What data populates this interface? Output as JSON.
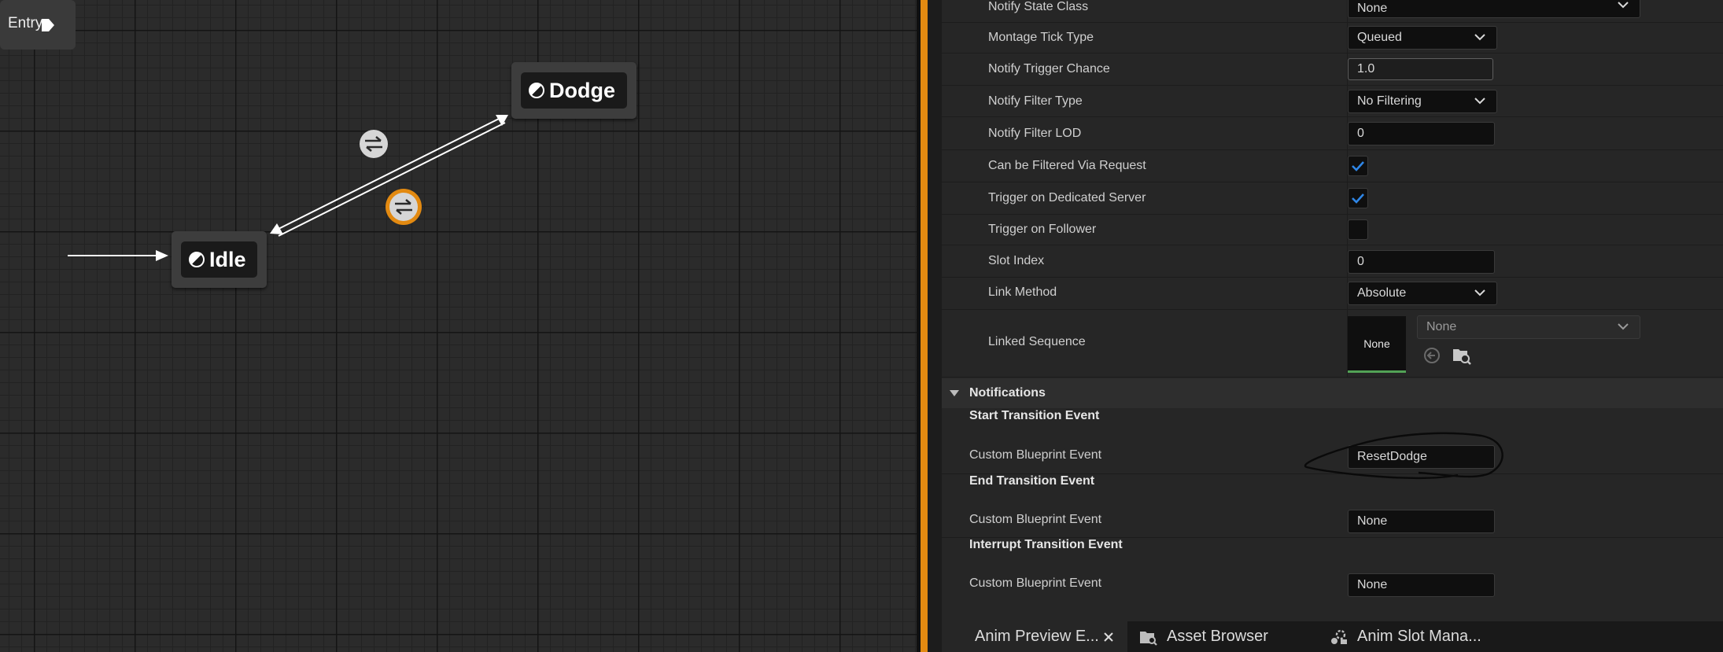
{
  "graph": {
    "nodes": {
      "entry": "Entry",
      "idle": "Idle",
      "dodge": "Dodge"
    },
    "icons": {
      "state": "state-icon",
      "transition": "transition-icon",
      "selected_transition": "transition-icon-selected",
      "entry_arrow": "play-arrow-icon"
    },
    "colors": {
      "selection": "#e38a11"
    }
  },
  "details": {
    "rows": {
      "notify_state_class": {
        "label": "Notify State Class",
        "value": "None"
      },
      "montage_tick_type": {
        "label": "Montage Tick Type",
        "value": "Queued"
      },
      "notify_trigger_chance": {
        "label": "Notify Trigger Chance",
        "value": "1.0"
      },
      "notify_filter_type": {
        "label": "Notify Filter Type",
        "value": "No Filtering"
      },
      "notify_filter_lod": {
        "label": "Notify Filter LOD",
        "value": "0"
      },
      "can_be_filtered": {
        "label": "Can be Filtered Via Request",
        "checked": true
      },
      "trigger_dedicated": {
        "label": "Trigger on Dedicated Server",
        "checked": true
      },
      "trigger_follower": {
        "label": "Trigger on Follower",
        "checked": false
      },
      "slot_index": {
        "label": "Slot Index",
        "value": "0"
      },
      "link_method": {
        "label": "Link Method",
        "value": "Absolute"
      },
      "linked_sequence": {
        "label": "Linked Sequence",
        "thumb": "None",
        "value": "None"
      }
    },
    "notifications": {
      "title": "Notifications",
      "start": {
        "title": "Start Transition Event",
        "label": "Custom Blueprint Event",
        "value": "ResetDodge"
      },
      "end": {
        "title": "End Transition Event",
        "label": "Custom Blueprint Event",
        "value": "None"
      },
      "interrupt": {
        "title": "Interrupt Transition Event",
        "label": "Custom Blueprint Event",
        "value": "None"
      }
    }
  },
  "tabs": [
    {
      "label": "Anim Preview E...",
      "icon": "close-icon"
    },
    {
      "label": "Asset Browser",
      "icon": "asset-browser-icon"
    },
    {
      "label": "Anim Slot Mana...",
      "icon": "anim-slot-icon"
    }
  ]
}
